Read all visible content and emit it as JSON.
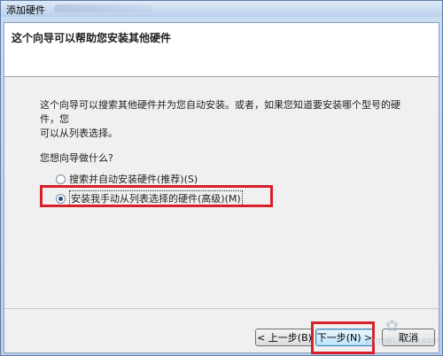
{
  "window": {
    "title": "添加硬件"
  },
  "header": {
    "title": "这个向导可以帮助您安装其他硬件"
  },
  "body": {
    "description_line1": "这个向导可以搜索其他硬件并为您自动安装。或者，如果您知道要安装哪个型号的硬件，您",
    "description_line2": "可以从列表选择。",
    "question": "您想向导做什么?",
    "options": [
      {
        "label": "搜索并自动安装硬件(推荐)(S)",
        "selected": false
      },
      {
        "label": "安装我手动从列表选择的硬件(高级)(M)",
        "selected": true
      }
    ]
  },
  "buttons": {
    "back": "< 上一步(B)",
    "next": "下一步(N) >",
    "cancel": "取消"
  },
  "watermark": {
    "text": "jingyan.baidu.com"
  },
  "colors": {
    "highlight": "#d8202b"
  }
}
